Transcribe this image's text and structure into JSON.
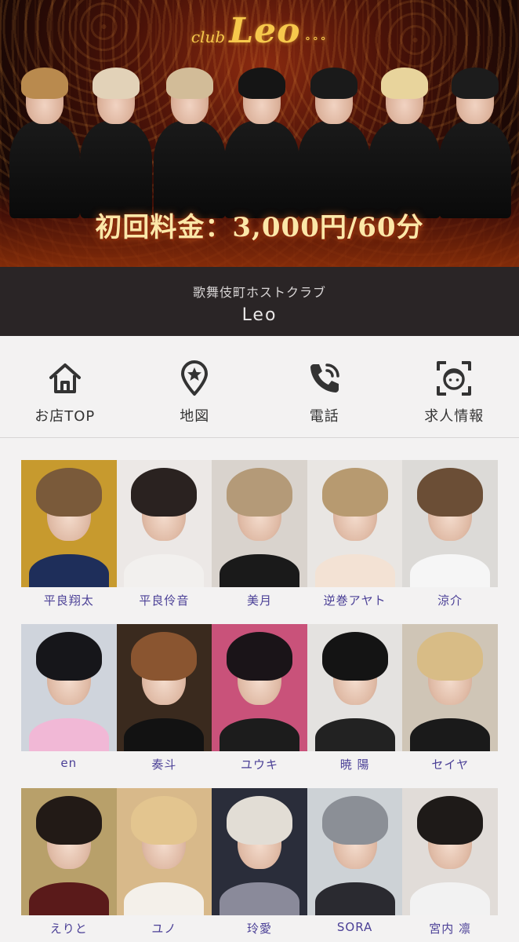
{
  "hero": {
    "logo_prefix": "club",
    "logo_name": "Leo",
    "logo_suffix": "∘∘∘",
    "price_text": "初回料金：3,000円/60分",
    "host_count": 7
  },
  "shop": {
    "subtitle": "歌舞伎町ホストクラブ",
    "name": "Leo"
  },
  "nav": {
    "items": [
      {
        "label": "お店TOP",
        "icon": "home-icon"
      },
      {
        "label": "地図",
        "icon": "map-pin-icon"
      },
      {
        "label": "電話",
        "icon": "phone-icon"
      },
      {
        "label": "求人情報",
        "icon": "face-scan-icon"
      }
    ]
  },
  "cast": [
    {
      "name": "平良翔太",
      "bg": "#c79a2e",
      "hair": "#7a5a3a",
      "top": "#1e2e5a"
    },
    {
      "name": "平良伶音",
      "bg": "#ece8e6",
      "hair": "#2a2220",
      "top": "#f2f0ee"
    },
    {
      "name": "美月",
      "bg": "#d9d3cd",
      "hair": "#b49a78",
      "top": "#1a1a1a"
    },
    {
      "name": "逆巻アヤト",
      "bg": "#e9e6e3",
      "hair": "#b79a70",
      "top": "#f3e2d4"
    },
    {
      "name": "涼介",
      "bg": "#dcdad7",
      "hair": "#6b4e36",
      "top": "#f6f6f6"
    },
    {
      "name": "en",
      "bg": "#cfd4dc",
      "hair": "#16161a",
      "top": "#f1b8d6"
    },
    {
      "name": "奏斗",
      "bg": "#3a2a1e",
      "hair": "#8a5530",
      "top": "#121212"
    },
    {
      "name": "ユウキ",
      "bg": "#c9527a",
      "hair": "#1a1418",
      "top": "#1c1c1c"
    },
    {
      "name": "暁 陽",
      "bg": "#e4e2e0",
      "hair": "#141414",
      "top": "#222"
    },
    {
      "name": "セイヤ",
      "bg": "#cfc5b6",
      "hair": "#d8bc86",
      "top": "#1a1a1a"
    },
    {
      "name": "えりと",
      "bg": "#b8a06a",
      "hair": "#221a16",
      "top": "#5a1a1a"
    },
    {
      "name": "ユノ",
      "bg": "#d8b98a",
      "hair": "#e3c58f",
      "top": "#f4f0ea"
    },
    {
      "name": "玲愛",
      "bg": "#2a2d3a",
      "hair": "#e2ddd5",
      "top": "#8a8a9a"
    },
    {
      "name": "SORA",
      "bg": "#cdd2d6",
      "hair": "#8b8f96",
      "top": "#2a2a30"
    },
    {
      "name": "宮内 凛",
      "bg": "#e1dcd8",
      "hair": "#1e1a18",
      "top": "#f2f2f2"
    }
  ]
}
